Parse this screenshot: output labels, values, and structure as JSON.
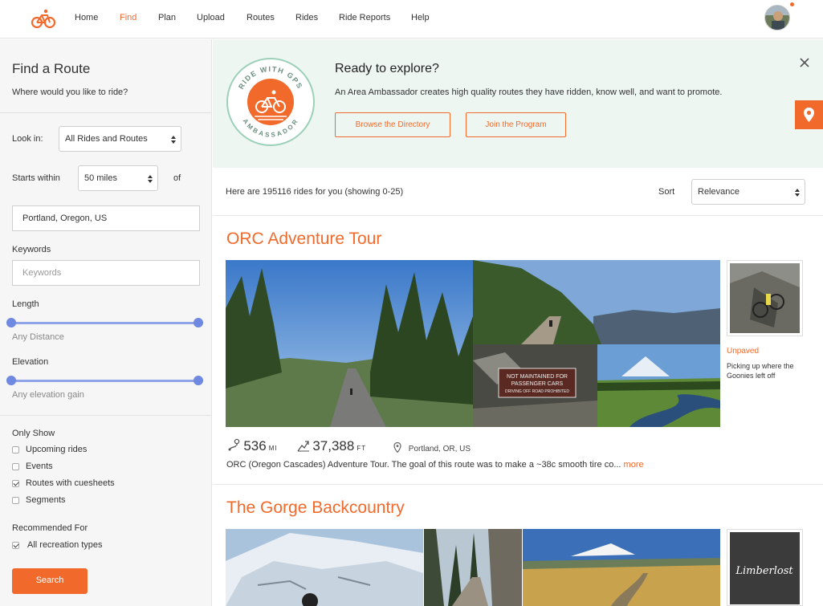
{
  "nav": {
    "items": [
      "Home",
      "Find",
      "Plan",
      "Upload",
      "Routes",
      "Rides",
      "Ride Reports",
      "Help"
    ],
    "active": "Find"
  },
  "sidebar": {
    "title": "Find a Route",
    "subtitle": "Where would you like to ride?",
    "look_in_label": "Look in:",
    "look_in_value": "All Rides and Routes",
    "starts_within_label": "Starts within",
    "starts_within_value": "50 miles",
    "of_label": "of",
    "location_value": "Portland, Oregon, US",
    "keywords_label": "Keywords",
    "keywords_placeholder": "Keywords",
    "length_label": "Length",
    "length_hint": "Any Distance",
    "elevation_label": "Elevation",
    "elevation_hint": "Any elevation gain",
    "only_show_label": "Only Show",
    "only_show": [
      {
        "label": "Upcoming rides",
        "checked": false
      },
      {
        "label": "Events",
        "checked": false
      },
      {
        "label": "Routes with cuesheets",
        "checked": true
      },
      {
        "label": "Segments",
        "checked": false
      }
    ],
    "recommended_label": "Recommended For",
    "recommended": [
      {
        "label": "All recreation types",
        "checked": true
      }
    ],
    "search_button": "Search"
  },
  "banner": {
    "badge_text_top": "RIDE WITH GPS",
    "badge_text_bottom": "AMBASSADOR",
    "title": "Ready to explore?",
    "text": "An Area Ambassador creates high quality routes they have ridden, know well, and want to promote.",
    "btn_directory": "Browse the Directory",
    "btn_program": "Join the Program"
  },
  "results": {
    "summary": "Here are 195116 rides for you (showing 0-25)",
    "sort_label": "Sort",
    "sort_value": "Relevance"
  },
  "rides": [
    {
      "title": "ORC Adventure Tour",
      "side_tag": "Unpaved",
      "side_desc": "Picking up where the Goonies left off",
      "sign_line1": "NOT MAINTAINED FOR",
      "sign_line2": "PASSENGER CARS",
      "sign_line3": "DRIVING OFF ROAD PROHIBITED",
      "distance": "536",
      "distance_unit": "MI",
      "elevation": "37,388",
      "elevation_unit": "FT",
      "location": "Portland, OR, US",
      "description": "ORC (Oregon Cascades) Adventure Tour. The goal of this route was to make a ~38c smooth tire co...",
      "more": "more"
    },
    {
      "title": "The Gorge Backcountry",
      "side_logo": "Limberlost"
    }
  ],
  "colors": {
    "accent": "#f26a2b",
    "slider": "#6f88e0",
    "banner_bg": "#eef6f2"
  }
}
